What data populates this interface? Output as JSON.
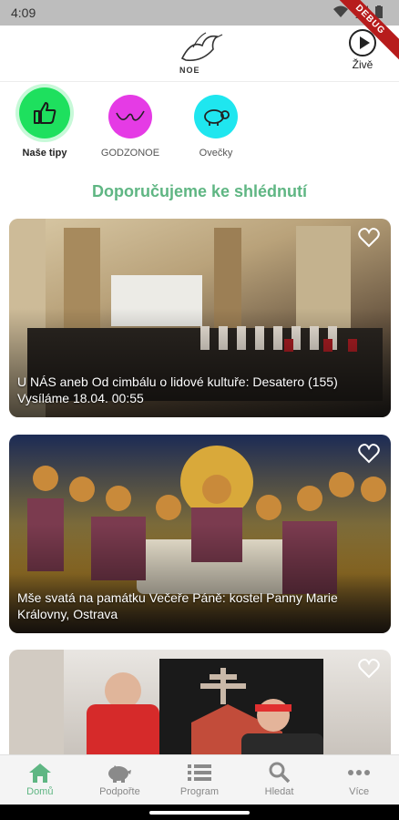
{
  "status_bar": {
    "time": "4:09",
    "debug_label": "DEBUG"
  },
  "header": {
    "logo_text": "NOE",
    "live_label": "Živě"
  },
  "categories": [
    {
      "label": "Naše tipy",
      "color": "#1ee05e",
      "icon": "thumbs-up-icon"
    },
    {
      "label": "GODZONOE",
      "color": "#e53be5",
      "icon": "scribble-icon"
    },
    {
      "label": "Ovečky",
      "color": "#1fe6ef",
      "icon": "sheep-icon"
    }
  ],
  "section_title": "Doporučujeme ke shlédnutí",
  "cards": [
    {
      "title_line1": "U NÁS aneb Od cimbálu o lidové kultuře: Desatero (155)",
      "title_line2": "Vysíláme 18.04. 00:55"
    },
    {
      "title_line1": "Mše svatá na památku Večeře Páně: kostel Panny Marie",
      "title_line2": "Královny, Ostrava"
    },
    {
      "title_line1": "",
      "title_line2": ""
    }
  ],
  "bottom_nav": [
    {
      "label": "Domů",
      "icon": "home-icon",
      "active": true
    },
    {
      "label": "Podpořte",
      "icon": "piggy-bank-icon",
      "active": false
    },
    {
      "label": "Program",
      "icon": "list-icon",
      "active": false
    },
    {
      "label": "Hledat",
      "icon": "search-icon",
      "active": false
    },
    {
      "label": "Více",
      "icon": "more-icon",
      "active": false
    }
  ],
  "colors": {
    "accent": "#5fb683"
  }
}
